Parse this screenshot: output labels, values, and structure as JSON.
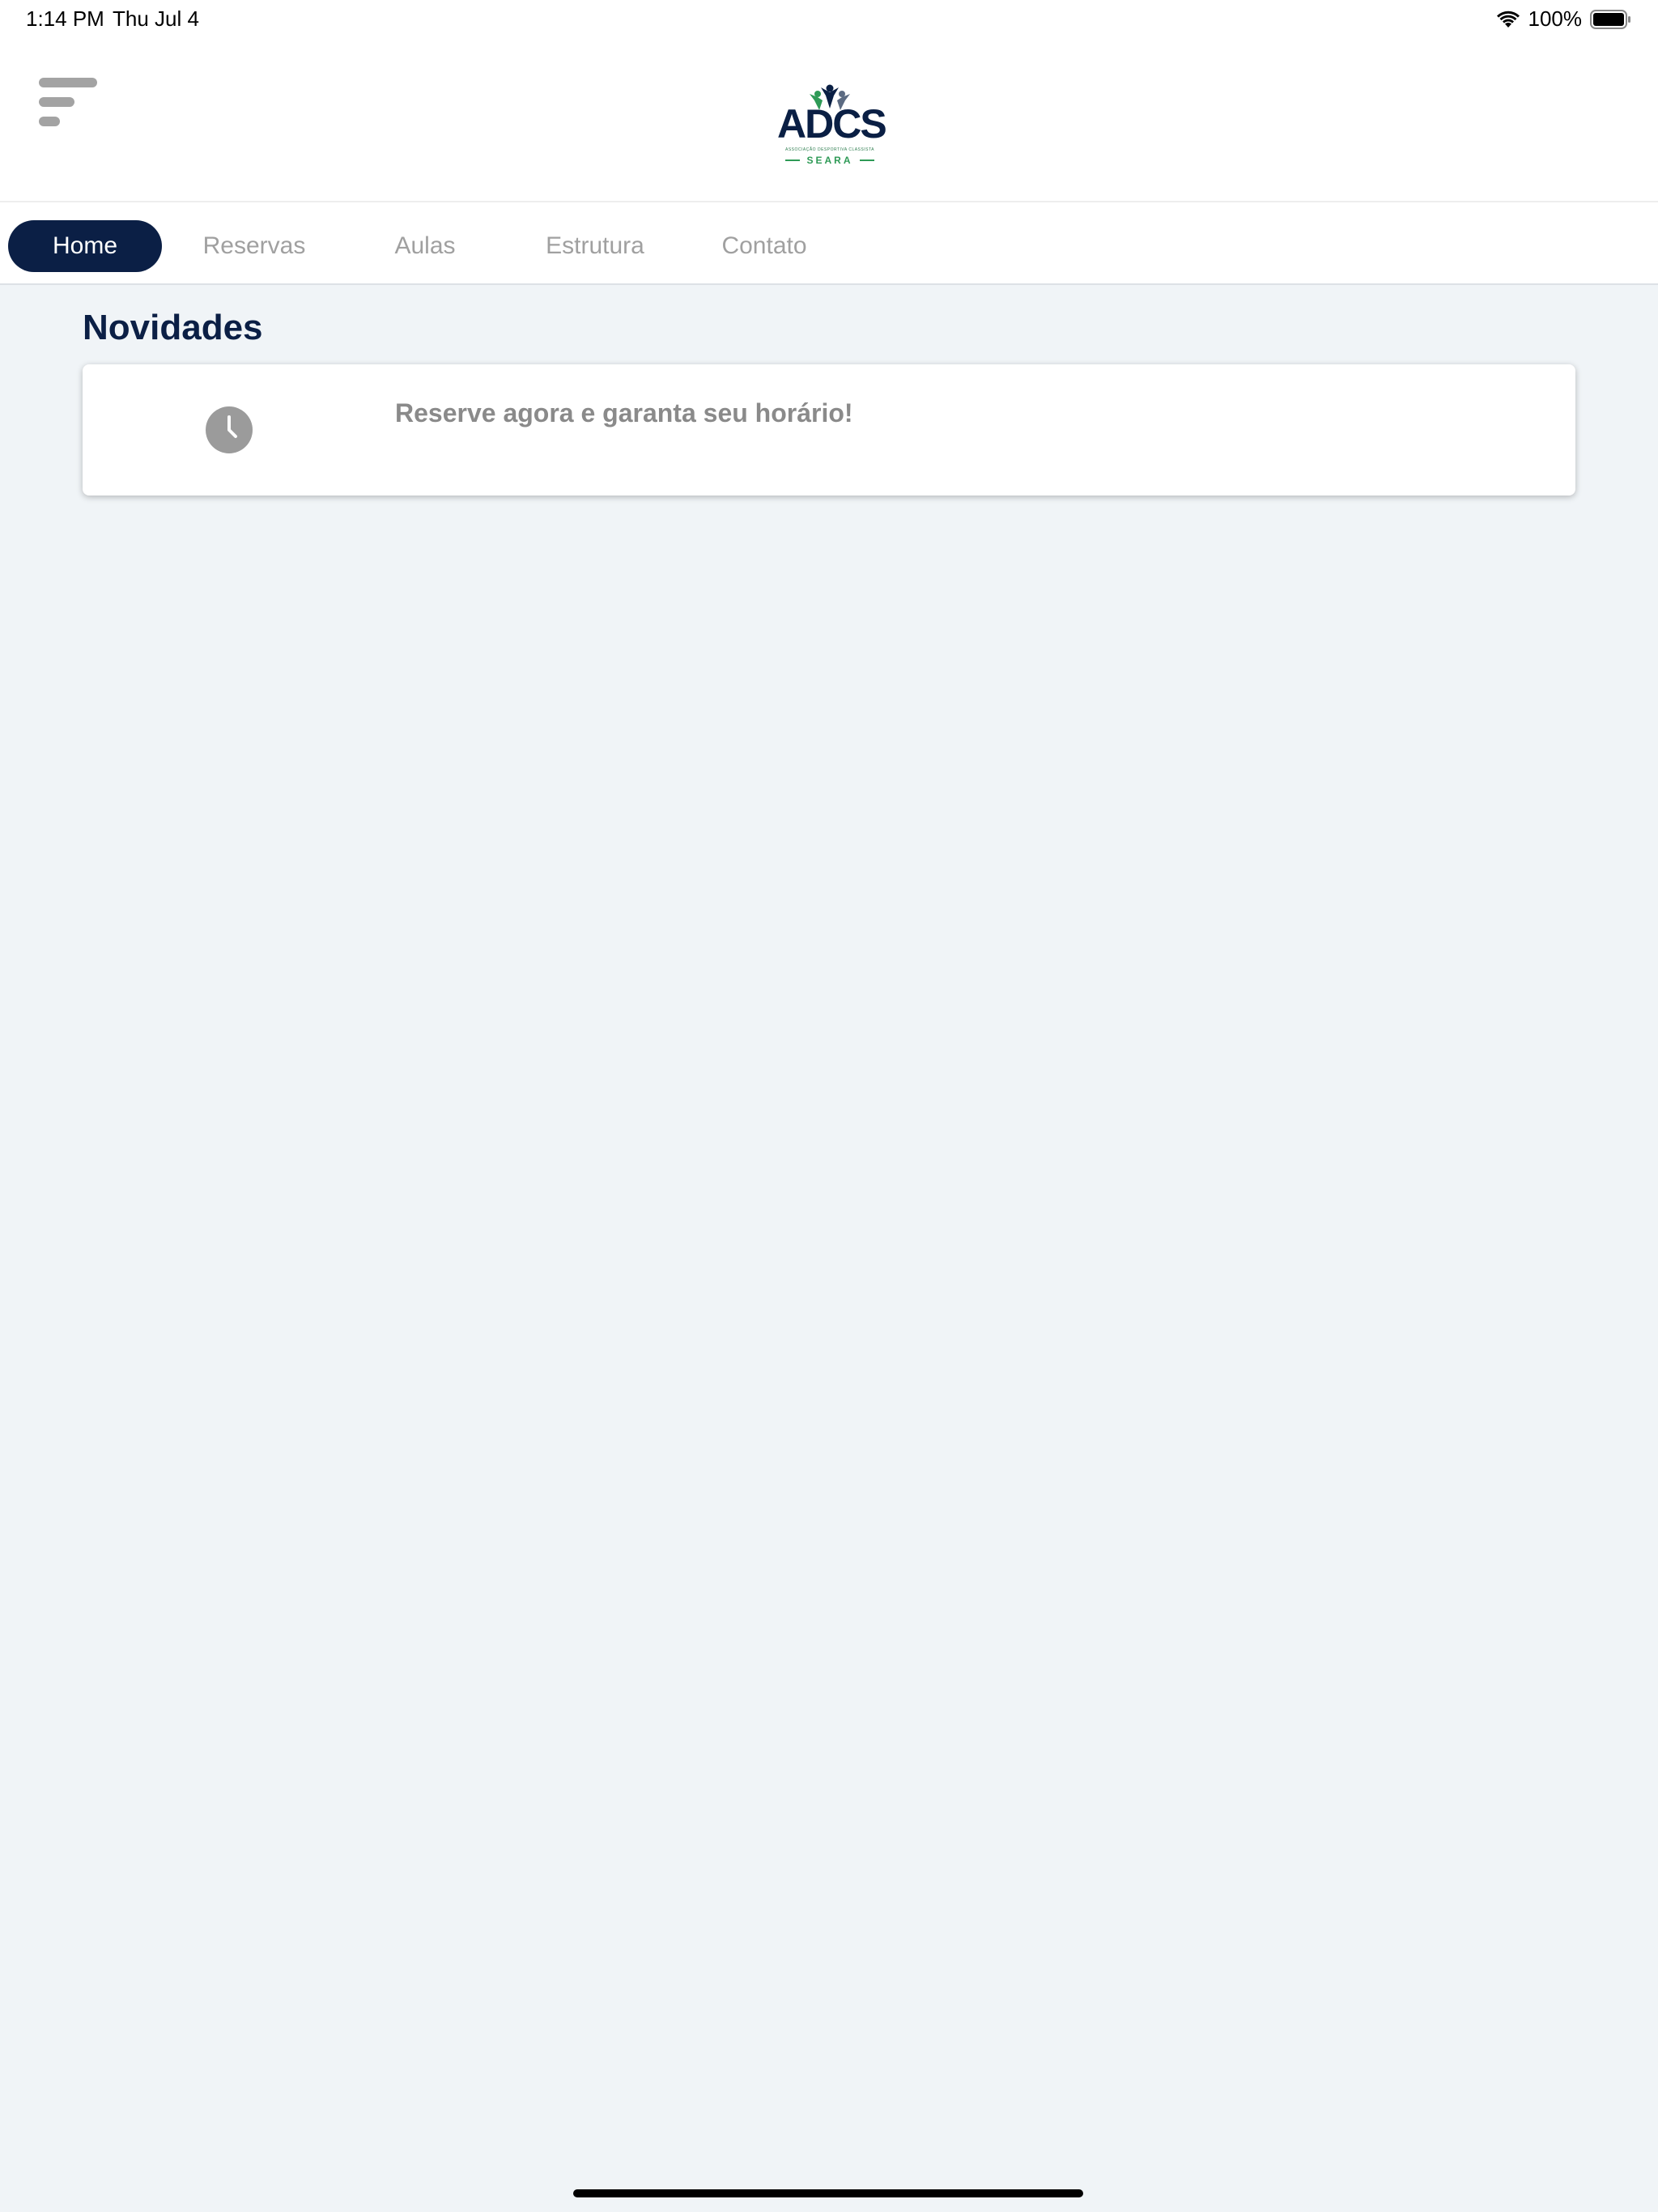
{
  "status_bar": {
    "time": "1:14 PM",
    "date": "Thu Jul 4",
    "battery": "100%",
    "icons": [
      "wifi-icon",
      "battery-icon"
    ]
  },
  "header": {
    "menu_icon": "menu-icon",
    "logo": {
      "text": "ADCS",
      "subtitle": "ASSOCIAÇÃO DESPORTIVA CLASSISTA",
      "tagline": "SEARA"
    }
  },
  "nav": {
    "tabs": [
      {
        "label": "Home",
        "active": true
      },
      {
        "label": "Reservas",
        "active": false
      },
      {
        "label": "Aulas",
        "active": false
      },
      {
        "label": "Estrutura",
        "active": false
      },
      {
        "label": "Contato",
        "active": false
      }
    ]
  },
  "main": {
    "section_title": "Novidades",
    "news": [
      {
        "icon": "clock-icon",
        "text": "Reserve agora e garanta seu horário!"
      }
    ]
  },
  "colors": {
    "brand_navy": "#0b1f45",
    "brand_green": "#2e9a56",
    "background": "#f0f4f7",
    "muted_text": "#8a8a8a"
  }
}
